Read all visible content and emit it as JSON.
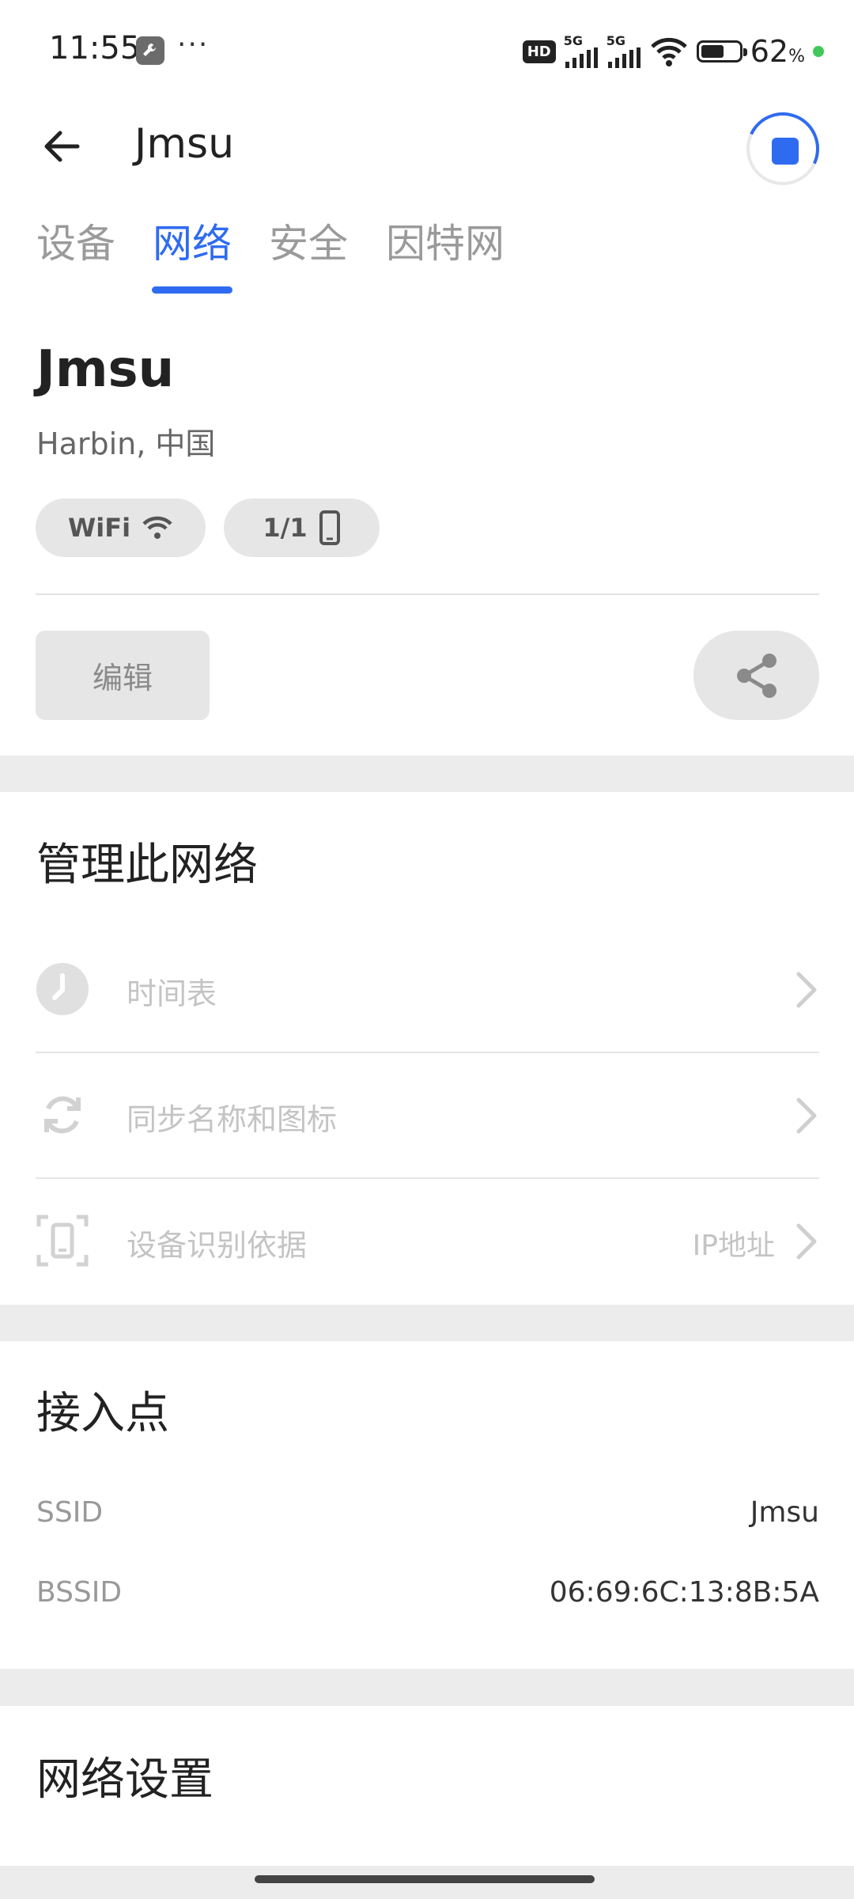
{
  "status_bar": {
    "time": "11:55",
    "dots": "···",
    "hd": "HD",
    "signal1": "5G",
    "signal2": "5G",
    "battery_pct": "62",
    "battery_unit": "%"
  },
  "header": {
    "title": "Jmsu",
    "tabs": [
      "设备",
      "网络",
      "安全",
      "因特网"
    ],
    "active_tab": "网络",
    "accent_color": "#2f6bf0"
  },
  "network": {
    "name": "Jmsu",
    "location": "Harbin, 中国",
    "chip_wifi": "WiFi",
    "chip_devices": "1/1",
    "edit_label": "编辑"
  },
  "manage": {
    "title": "管理此网络",
    "items": [
      {
        "label": "时间表",
        "value": "",
        "icon": "clock-icon"
      },
      {
        "label": "同步名称和图标",
        "value": "",
        "icon": "sync-icon"
      },
      {
        "label": "设备识别依据",
        "value": "IP地址",
        "icon": "device-scan-icon"
      }
    ]
  },
  "access_point": {
    "title": "接入点",
    "ssid_key": "SSID",
    "ssid_value": "Jmsu",
    "bssid_key": "BSSID",
    "bssid_value": "06:69:6C:13:8B:5A"
  },
  "network_settings": {
    "title": "网络设置"
  }
}
